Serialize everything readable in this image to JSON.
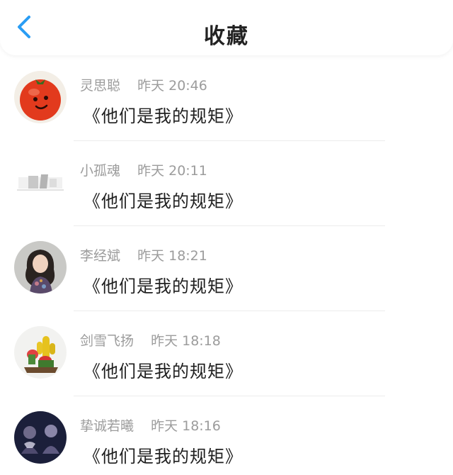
{
  "header": {
    "title": "收藏",
    "back_icon": "chevron-left-icon",
    "accent": "#2a9df4"
  },
  "favorites": [
    {
      "name": "灵思聪",
      "time": "昨天 20:46",
      "message": "《他们是我的规矩》",
      "avatar": "tomato-avatar"
    },
    {
      "name": "小孤魂",
      "time": "昨天 20:11",
      "message": "《他们是我的规矩》",
      "avatar": "grey-sketch-avatar"
    },
    {
      "name": "李经斌",
      "time": "昨天 18:21",
      "message": "《他们是我的规矩》",
      "avatar": "woman-portrait-avatar"
    },
    {
      "name": "剑雪飞扬",
      "time": "昨天 18:18",
      "message": "《他们是我的规矩》",
      "avatar": "cactus-avatar"
    },
    {
      "name": "挚诚若曦",
      "time": "昨天 18:16",
      "message": "《他们是我的规矩》",
      "avatar": "dark-stage-avatar"
    }
  ]
}
